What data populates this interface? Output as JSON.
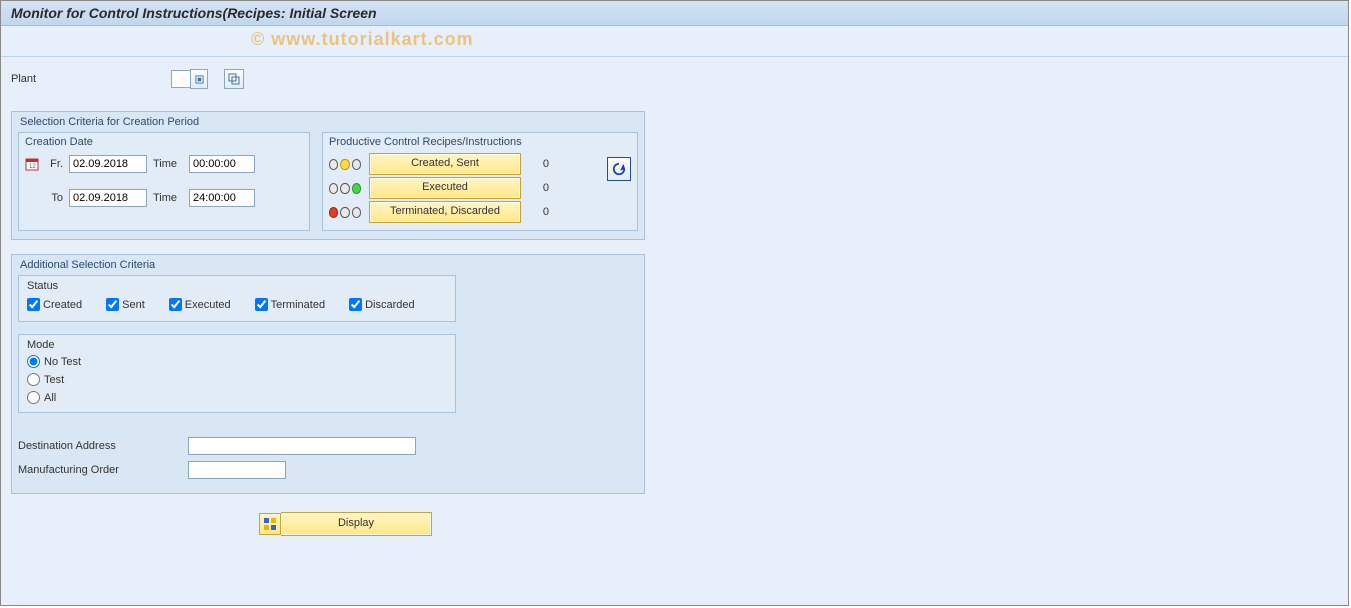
{
  "header": {
    "title": "Monitor for Control Instructions(Recipes: Initial Screen",
    "watermark": "© www.tutorialkart.com"
  },
  "plant": {
    "label": "Plant",
    "value": ""
  },
  "selection_creation": {
    "title": "Selection Criteria for Creation Period",
    "creation_date": {
      "title": "Creation Date",
      "from_label": "Fr.",
      "to_label": "To",
      "time_label": "Time",
      "from_date": "02.09.2018",
      "from_time": "00:00:00",
      "to_date": "02.09.2018",
      "to_time": "24:00:00"
    },
    "productive": {
      "title": "Productive Control Recipes/Instructions",
      "rows": [
        {
          "label": "Created, Sent",
          "count": "0"
        },
        {
          "label": "Executed",
          "count": "0"
        },
        {
          "label": "Terminated, Discarded",
          "count": "0"
        }
      ]
    }
  },
  "additional": {
    "title": "Additional Selection Criteria",
    "status": {
      "title": "Status",
      "items": [
        {
          "label": "Created",
          "checked": true
        },
        {
          "label": "Sent",
          "checked": true
        },
        {
          "label": "Executed",
          "checked": true
        },
        {
          "label": "Terminated",
          "checked": true
        },
        {
          "label": "Discarded",
          "checked": true
        }
      ]
    },
    "mode": {
      "title": "Mode",
      "options": [
        {
          "label": "No Test",
          "selected": true
        },
        {
          "label": "Test",
          "selected": false
        },
        {
          "label": "All",
          "selected": false
        }
      ]
    },
    "dest_addr": {
      "label": "Destination Address",
      "value": ""
    },
    "mfg_order": {
      "label": "Manufacturing Order",
      "value": ""
    }
  },
  "footer": {
    "display_label": "Display"
  }
}
